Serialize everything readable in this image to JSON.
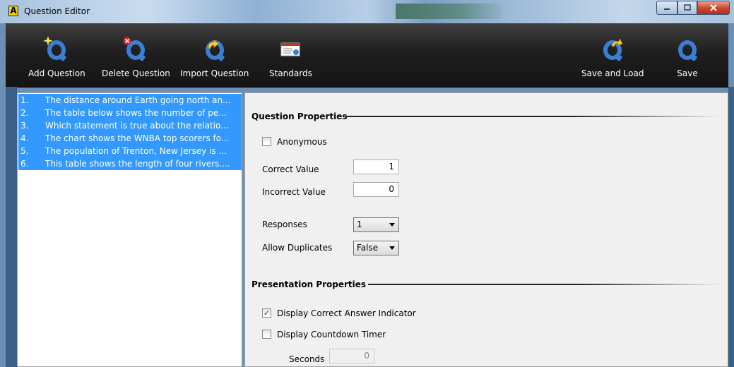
{
  "window": {
    "title": "Question Editor"
  },
  "toolbar": {
    "add_question": "Add Question",
    "delete_question": "Delete Question",
    "import_question": "Import Question",
    "standards": "Standards",
    "save_and_load": "Save and Load",
    "save": "Save"
  },
  "questions": [
    {
      "num": "1.",
      "text": "The distance around Earth going north an..."
    },
    {
      "num": "2.",
      "text": "The table below shows the number of pe..."
    },
    {
      "num": "3.",
      "text": "Which statement is true about the relatio..."
    },
    {
      "num": "4.",
      "text": "The chart shows the WNBA top scorers fo..."
    },
    {
      "num": "5.",
      "text": "The population of Trenton, New Jersey is ..."
    },
    {
      "num": "6.",
      "text": "This table shows the length of four rivers...."
    }
  ],
  "question_properties": {
    "heading": "Question Properties",
    "anonymous_label": "Anonymous",
    "anonymous_checked": false,
    "correct_value_label": "Correct Value",
    "correct_value": "1",
    "incorrect_value_label": "Incorrect Value",
    "incorrect_value": "0",
    "responses_label": "Responses",
    "responses_value": "1",
    "allow_duplicates_label": "Allow Duplicates",
    "allow_duplicates_value": "False"
  },
  "presentation_properties": {
    "heading": "Presentation Properties",
    "display_correct_label": "Display Correct Answer Indicator",
    "display_correct_checked": true,
    "display_countdown_label": "Display Countdown Timer",
    "display_countdown_checked": false,
    "seconds_label": "Seconds",
    "seconds_value": "0"
  },
  "colors": {
    "selection": "#3399ff",
    "toolbar": "#1f1f1f",
    "icon_blue": "#3a7fd1"
  }
}
